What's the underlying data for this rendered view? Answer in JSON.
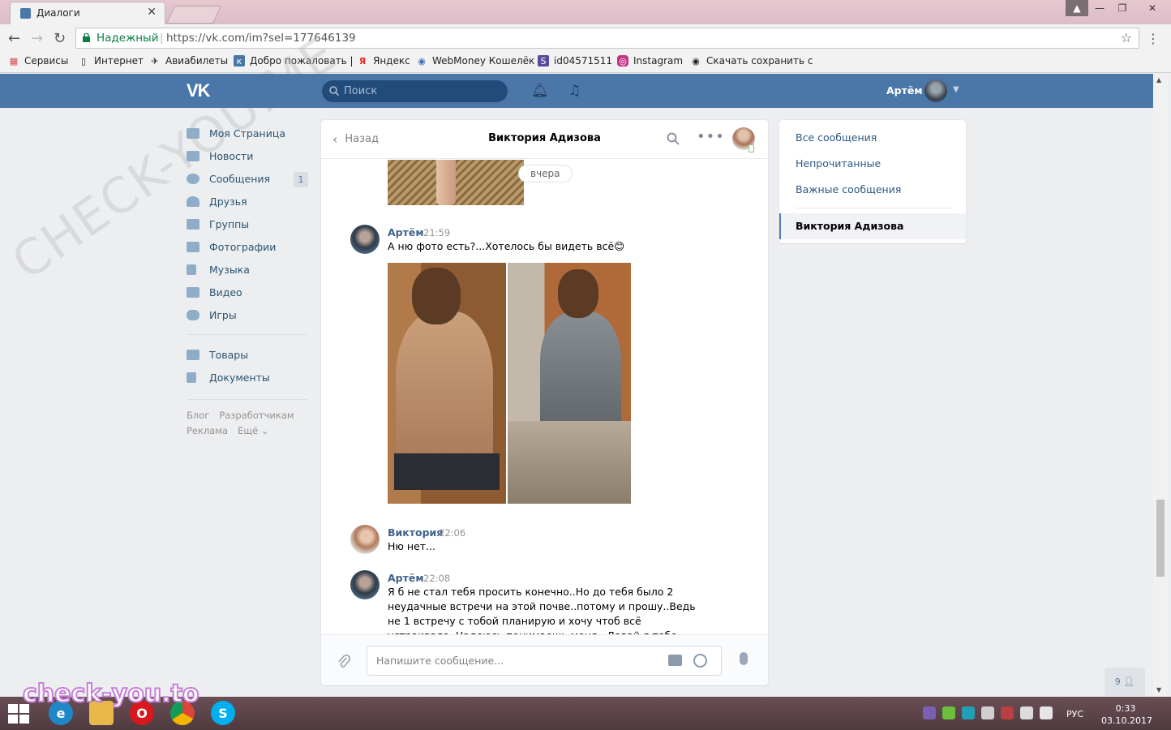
{
  "browser": {
    "tab_title": "Диалоги",
    "secure_label": "Надежный",
    "url": "https://vk.com/im?sel=177646139",
    "bookmarks": [
      "Сервисы",
      "Интернет",
      "Авиабилеты",
      "Добро пожаловать |",
      "Яндекс",
      "WebMoney Кошелёк",
      "id04571511",
      "Instagram",
      "Скачать сохранить с"
    ]
  },
  "header": {
    "search_placeholder": "Поиск",
    "user_name": "Артём"
  },
  "left_menu": {
    "items": [
      {
        "label": "Моя Страница",
        "icon": "home-icon"
      },
      {
        "label": "Новости",
        "icon": "news-icon"
      },
      {
        "label": "Сообщения",
        "icon": "messages-icon",
        "badge": "1"
      },
      {
        "label": "Друзья",
        "icon": "friend-icon"
      },
      {
        "label": "Группы",
        "icon": "groups-icon"
      },
      {
        "label": "Фотографии",
        "icon": "camera-icon"
      },
      {
        "label": "Музыка",
        "icon": "music-icon"
      },
      {
        "label": "Видео",
        "icon": "video-icon"
      },
      {
        "label": "Игры",
        "icon": "gamepad-icon"
      }
    ],
    "items2": [
      {
        "label": "Товары",
        "icon": "bag-icon"
      },
      {
        "label": "Документы",
        "icon": "document-icon"
      }
    ],
    "footer": [
      "Блог",
      "Разработчикам",
      "Реклама",
      "Ещё ⌄"
    ]
  },
  "dialog": {
    "back_label": "Назад",
    "title": "Виктория Адизова",
    "date_pill": "вчера",
    "messages": [
      {
        "author": "Артём",
        "time": "21:59",
        "text": "А ню фото есть?...Хотелось бы видеть всё😊"
      },
      {
        "author": "Виктория",
        "time": "22:06",
        "text": "Ню нет..."
      },
      {
        "author": "Артём",
        "time": "22:08",
        "text": "Я б не стал тебя просить конечно..Но до тебя было 2 неудачные встречи на этой почве..потому и прошу..Ведь не 1 встречу с тобой планирую и хочу чтоб всё устраивало..Надеюсь понимаешь меня...Давай я тебе"
      }
    ],
    "composer_placeholder": "Напишите сообщение..."
  },
  "right_menu": {
    "items": [
      "Все сообщения",
      "Непрочитанные",
      "Важные сообщения"
    ],
    "active": "Виктория Адизова"
  },
  "chat_counter": "9",
  "taskbar": {
    "lang": "РУС",
    "time": "0:33",
    "date": "03.10.2017"
  },
  "watermark": "check-you.to",
  "watermark_diag": "CHECK-YOU.ME"
}
